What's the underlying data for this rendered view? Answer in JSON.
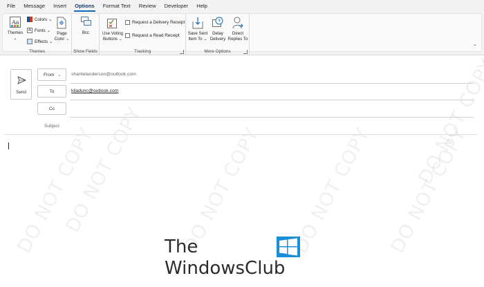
{
  "tabs": [
    {
      "label": "File",
      "active": false
    },
    {
      "label": "Message",
      "active": false
    },
    {
      "label": "Insert",
      "active": false
    },
    {
      "label": "Options",
      "active": true
    },
    {
      "label": "Format Text",
      "active": false
    },
    {
      "label": "Review",
      "active": false
    },
    {
      "label": "Developer",
      "active": false
    },
    {
      "label": "Help",
      "active": false
    }
  ],
  "ribbon": {
    "themes": {
      "themes_label": "Themes",
      "colors_label": "Colors",
      "fonts_label": "Fonts",
      "effects_label": "Effects",
      "page_color_line1": "Page",
      "page_color_line2": "Color",
      "group_label": "Themes"
    },
    "show_fields": {
      "bcc_label": "Bcc",
      "group_label": "Show Fields"
    },
    "tracking": {
      "voting_line1": "Use Voting",
      "voting_line2": "Buttons",
      "delivery_receipt": "Request a Delivery Receipt",
      "read_receipt": "Request a Read Receipt",
      "group_label": "Tracking"
    },
    "more_options": {
      "save_sent_line1": "Save Sent",
      "save_sent_line2": "Item To",
      "delay_line1": "Delay",
      "delay_line2": "Delivery",
      "direct_line1": "Direct",
      "direct_line2": "Replies To",
      "group_label": "More Options"
    }
  },
  "compose": {
    "send_label": "Send",
    "from_label": "From",
    "from_value": "shantelanderson@outlook.com",
    "to_label": "To",
    "to_value": "kiladunc@outlook.com",
    "cc_label": "Cc",
    "cc_value": "",
    "subject_label": "Subject",
    "subject_value": ""
  },
  "watermark": {
    "text": "DO NOT COPY"
  },
  "logo": {
    "line1": "The",
    "line2": "WindowsClub"
  },
  "colors": {
    "accent": "#0f6cbd",
    "window_logo": "#1a8fd8"
  }
}
